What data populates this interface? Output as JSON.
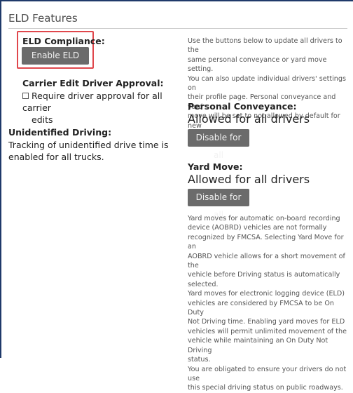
{
  "section_title": "ELD Features",
  "eld_compliance": {
    "label": "ELD Compliance:",
    "button": "Enable ELD"
  },
  "carrier_edit": {
    "label": "Carrier Edit Driver Approval:",
    "checkbox_text_line1": "Require driver approval for all carrier",
    "checkbox_text_line2": "edits"
  },
  "unidentified": {
    "label": "Unidentified Driving:",
    "text_line1": "Tracking of unidentified drive time is",
    "text_line2": "enabled for all trucks."
  },
  "intro_text": [
    "Use the buttons below to update all drivers to the",
    "same personal conveyance or yard move setting.",
    "You can also update individual drivers' settings on",
    "their profile page. Personal conveyance and yard",
    "move will be set to not allowed by default for new",
    "drivers added."
  ],
  "personal_conveyance": {
    "label": "Personal Conveyance:",
    "value": "Allowed for all drivers",
    "button": "Disable for all"
  },
  "yard_move": {
    "label": "Yard Move:",
    "value": "Allowed for all drivers",
    "button": "Disable for all"
  },
  "yard_notes": [
    "Yard moves for automatic on-board recording",
    "device (AOBRD) vehicles are not formally",
    "recognized by FMCSA. Selecting Yard Move for an",
    "AOBRD vehicle allows for a short movement of the",
    "vehicle before Driving status is automatically",
    "selected.",
    "Yard moves for electronic logging device (ELD)",
    "vehicles are considered by FMCSA to be On Duty",
    "Not Driving time. Enabling yard moves for ELD",
    "vehicles will permit unlimited movement of the",
    "vehicle while maintaining an On Duty Not Driving",
    "status.",
    "You are obligated to ensure your drivers do not use",
    "this special driving status on public roadways."
  ]
}
